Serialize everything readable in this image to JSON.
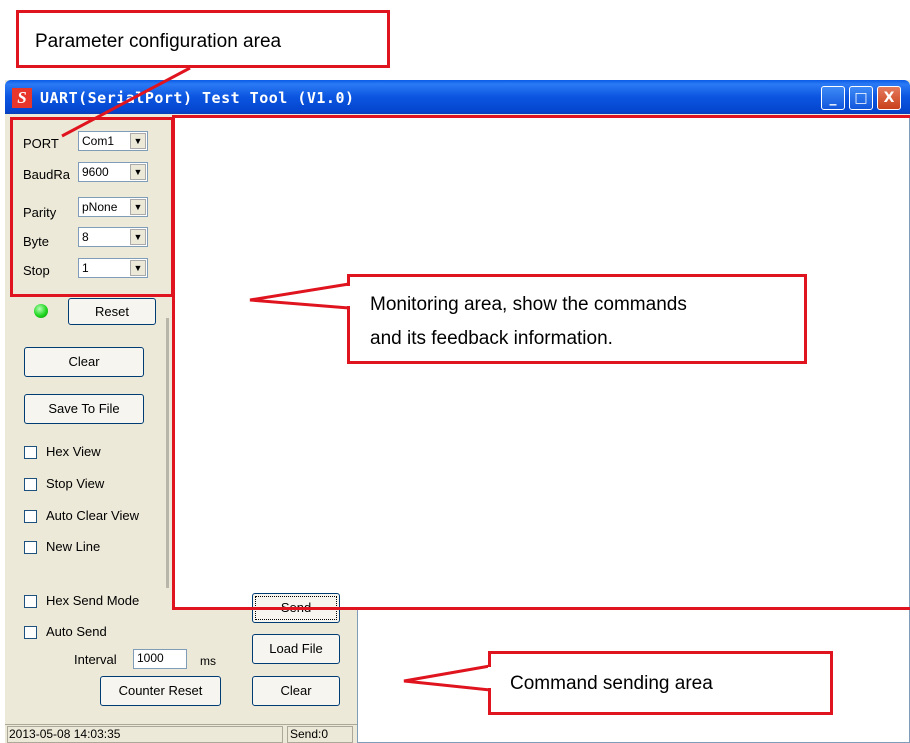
{
  "window": {
    "title": "UART(SerialPort) Test Tool (V1.0)",
    "logo_letter": "S",
    "controls": [
      "_",
      "□",
      "X"
    ]
  },
  "config": {
    "fields": [
      {
        "label": "PORT",
        "value": "Com1"
      },
      {
        "label": "BaudRa",
        "value": "9600"
      },
      {
        "label": "Parity",
        "value": "pNone"
      },
      {
        "label": "Byte",
        "value": "8"
      },
      {
        "label": "Stop",
        "value": "1"
      }
    ],
    "status_led_color": "#1fd61f",
    "reset_label": "Reset"
  },
  "actions": {
    "clear_label": "Clear",
    "save_label": "Save To File"
  },
  "checkboxes": {
    "hex_view": "Hex View",
    "stop_view": "Stop View",
    "auto_clear_view": "Auto Clear View",
    "new_line": "New Line",
    "hex_send_mode": "Hex Send Mode",
    "auto_send": "Auto Send"
  },
  "send": {
    "interval_label": "Interval",
    "interval_value": "1000",
    "interval_unit": "ms",
    "counter_reset_label": "Counter Reset",
    "send_label": "Send",
    "load_file_label": "Load File",
    "clear_label": "Clear"
  },
  "statusbar": {
    "datetime": "2013-05-08 14:03:35",
    "send_count": "Send:0"
  },
  "annotations": {
    "param_area": "Parameter configuration area",
    "monitor_area_line1": "Monitoring area, show the commands",
    "monitor_area_line2": "and its feedback information.",
    "command_area": "Command sending area"
  },
  "colors": {
    "annotation_red": "#e0141e",
    "titlebar_blue": "#0b55e0"
  }
}
